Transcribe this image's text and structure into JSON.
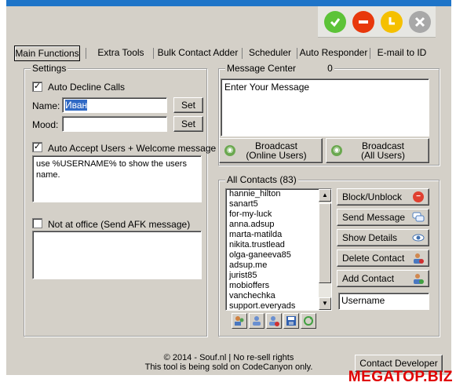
{
  "tabs": [
    {
      "label": "Main Functions",
      "active": true
    },
    {
      "label": "Extra Tools"
    },
    {
      "label": "Bulk Contact Adder"
    },
    {
      "label": "Scheduler"
    },
    {
      "label": "Auto Responder"
    },
    {
      "label": "E-mail to ID"
    }
  ],
  "tray": {
    "colors": [
      "#5cc338",
      "#e8380c",
      "#f5c000",
      "#a8a8a8"
    ],
    "icons": [
      "checkmark-icon",
      "minus-icon",
      "clock-icon",
      "close-icon"
    ]
  },
  "settings": {
    "title": "Settings",
    "auto_decline_label": "Auto Decline Calls",
    "auto_decline_checked": true,
    "name_label": "Name:",
    "name_value": "Иван",
    "mood_label": "Mood:",
    "mood_value": "",
    "set_label": "Set",
    "auto_accept_label": "Auto Accept Users + Welcome message",
    "auto_accept_checked": true,
    "welcome_text": "use %USERNAME% to show the users name.",
    "afk_label": "Not at office (Send AFK message)",
    "afk_checked": false,
    "afk_text": ""
  },
  "message_center": {
    "title": "Message Center",
    "count": "0",
    "message": "Enter Your Message",
    "broadcast_online_line1": "Broadcast",
    "broadcast_online_line2": "(Online Users)",
    "broadcast_all_line1": "Broadcast",
    "broadcast_all_line2": "(All Users)"
  },
  "contacts": {
    "title": "All Contacts (83)",
    "items": [
      "hannie_hilton",
      "sanart5",
      "for-my-luck",
      "anna.adsup",
      "marta-matilda",
      "nikita.trustlead",
      "olga-ganeeva85",
      "adsup.me",
      "jurist85",
      "mobioffers",
      "vanchechka",
      "support.everyads"
    ],
    "actions": {
      "block": "Block/Unblock",
      "send": "Send Message",
      "details": "Show Details",
      "delete": "Delete Contact",
      "add": "Add Contact"
    },
    "username_value": "Username"
  },
  "footer": {
    "line1": "© 2014 - Souf.nl | No re-sell rights",
    "line2": "This tool is being sold on CodeCanyon only.",
    "contact_button": "Contact Developer"
  },
  "watermark": "MEGATOP.BIZ"
}
